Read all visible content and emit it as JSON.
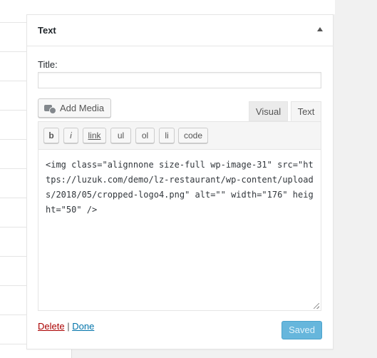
{
  "widget": {
    "title": "Text",
    "title_label": "Title:",
    "title_value": "",
    "add_media_label": "Add Media",
    "tabs": {
      "visual": "Visual",
      "text": "Text"
    },
    "quicktags": [
      "b",
      "i",
      "link",
      "ul",
      "ol",
      "li",
      "code"
    ],
    "content": "<img class=\"alignnone size-full wp-image-31\" src=\"https://luzuk.com/demo/lz-restaurant/wp-content/uploads/2018/05/cropped-logo4.png\" alt=\"\" width=\"176\" height=\"50\" />",
    "delete_label": "Delete",
    "separator": "|",
    "done_label": "Done",
    "save_label": "Saved"
  },
  "colors": {
    "save_button": "#66b6dc",
    "delete_link": "#aa0000",
    "done_link": "#0073aa"
  }
}
